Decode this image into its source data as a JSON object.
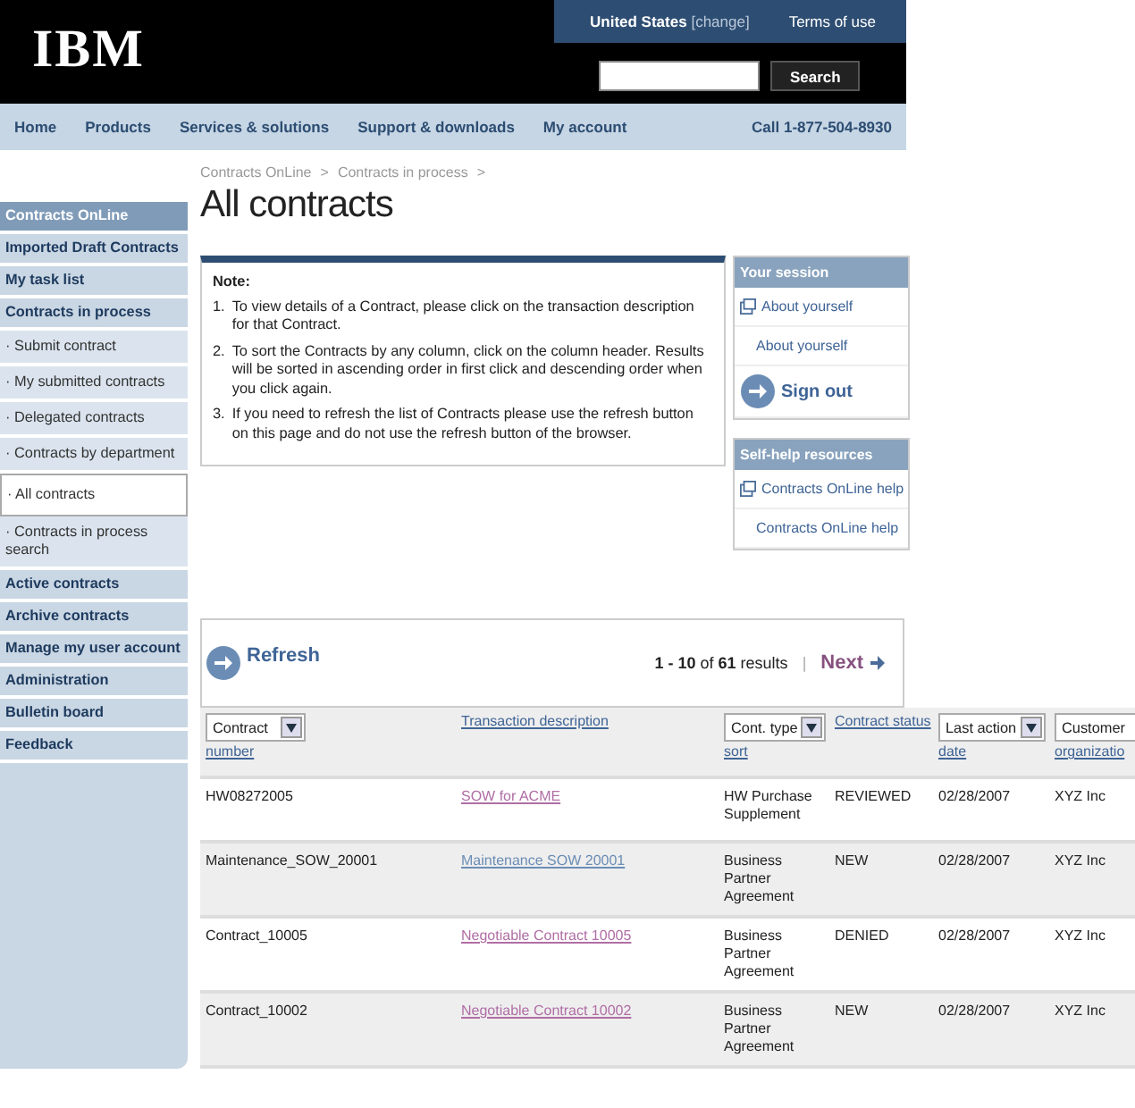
{
  "header": {
    "logo": "IBM",
    "country": "United States",
    "change": "[change]",
    "terms": "Terms of use",
    "search_button": "Search"
  },
  "nav": {
    "items": [
      "Home",
      "Products",
      "Services & solutions",
      "Support & downloads",
      "My account"
    ],
    "phone": "Call 1-877-504-8930"
  },
  "breadcrumb": {
    "items": [
      "Contracts OnLine",
      "Contracts in process"
    ],
    "separator": ">"
  },
  "page_title": "All contracts",
  "sidebar": {
    "items": [
      {
        "label": "Contracts OnLine",
        "kind": "header",
        "selected": false
      },
      {
        "label": "Imported Draft Contracts",
        "kind": "section",
        "selected": false
      },
      {
        "label": "My task list",
        "kind": "section",
        "selected": false
      },
      {
        "label": "Contracts in process",
        "kind": "section",
        "selected": false
      },
      {
        "label": "· Submit contract",
        "kind": "sub",
        "selected": false
      },
      {
        "label": "· My submitted contracts",
        "kind": "sub",
        "selected": false
      },
      {
        "label": "· Delegated contracts",
        "kind": "sub",
        "selected": false
      },
      {
        "label": "· Contracts by department",
        "kind": "sub",
        "selected": false
      },
      {
        "label": "· All contracts",
        "kind": "sub",
        "selected": true
      },
      {
        "label": "· Contracts in process search",
        "kind": "sub",
        "selected": false
      },
      {
        "label": "Active contracts",
        "kind": "section",
        "selected": false
      },
      {
        "label": "Archive contracts",
        "kind": "section",
        "selected": false
      },
      {
        "label": "Manage my user account",
        "kind": "section",
        "selected": false
      },
      {
        "label": "Administration",
        "kind": "section",
        "selected": false
      },
      {
        "label": "Bulletin board",
        "kind": "section",
        "selected": false
      },
      {
        "label": "Feedback",
        "kind": "section",
        "selected": false
      }
    ]
  },
  "note": {
    "title": "Note:",
    "items": [
      {
        "number": "1.",
        "text": "To view details of a Contract, please click on the transaction description for that Contract."
      },
      {
        "number": "2.",
        "text": "To sort the Contracts by any column, click on the column header. Results will be sorted in ascending order in first click and descending order when you click again."
      },
      {
        "number": "3.",
        "text": "If you need to refresh the list of Contracts please use the refresh button on this page and do not use the refresh button of the browser."
      }
    ]
  },
  "session": {
    "title": "Your session",
    "links": [
      {
        "label": "About yourself",
        "kind": "icon-link"
      },
      {
        "label": "About yourself",
        "kind": "plain"
      },
      {
        "label": "Sign out",
        "kind": "button"
      }
    ]
  },
  "help": {
    "title": "Self-help resources",
    "links": [
      {
        "label": "Contracts OnLine help",
        "kind": "icon-link"
      },
      {
        "label": "Contracts OnLine help",
        "kind": "plain"
      }
    ]
  },
  "results": {
    "refresh": "Refresh",
    "summary": "**1 - 10** of **61** results",
    "separator": "|",
    "next": "Next"
  },
  "table": {
    "columns": [
      {
        "kind": "select",
        "select": "Contract",
        "link": "number"
      },
      {
        "kind": "link",
        "link": "Transaction description"
      },
      {
        "kind": "select",
        "select": "Cont. type",
        "link": "sort"
      },
      {
        "kind": "link",
        "link": "Contract status"
      },
      {
        "kind": "select",
        "select": "Last action",
        "link": "date"
      },
      {
        "kind": "select-cut",
        "select": "Customer",
        "link": "organizatio"
      }
    ],
    "rows": [
      {
        "visited": true,
        "cells": [
          "HW08272005",
          "SOW for ACME",
          "HW Purchase Supplement",
          "REVIEWED",
          "02/28/2007",
          "XYZ Inc"
        ]
      },
      {
        "visited": false,
        "cells": [
          "Maintenance_SOW_20001",
          "Maintenance SOW 20001",
          "Business Partner Agreement",
          "NEW",
          "02/28/2007",
          "XYZ Inc"
        ]
      },
      {
        "visited": true,
        "cells": [
          "Contract_10005",
          "Negotiable Contract 10005",
          "Business Partner Agreement",
          "DENIED",
          "02/28/2007",
          "XYZ Inc"
        ]
      },
      {
        "visited": true,
        "cells": [
          "Contract_10002",
          "Negotiable Contract 10002",
          "Business Partner Agreement",
          "NEW",
          "02/28/2007",
          "XYZ Inc"
        ]
      }
    ]
  }
}
